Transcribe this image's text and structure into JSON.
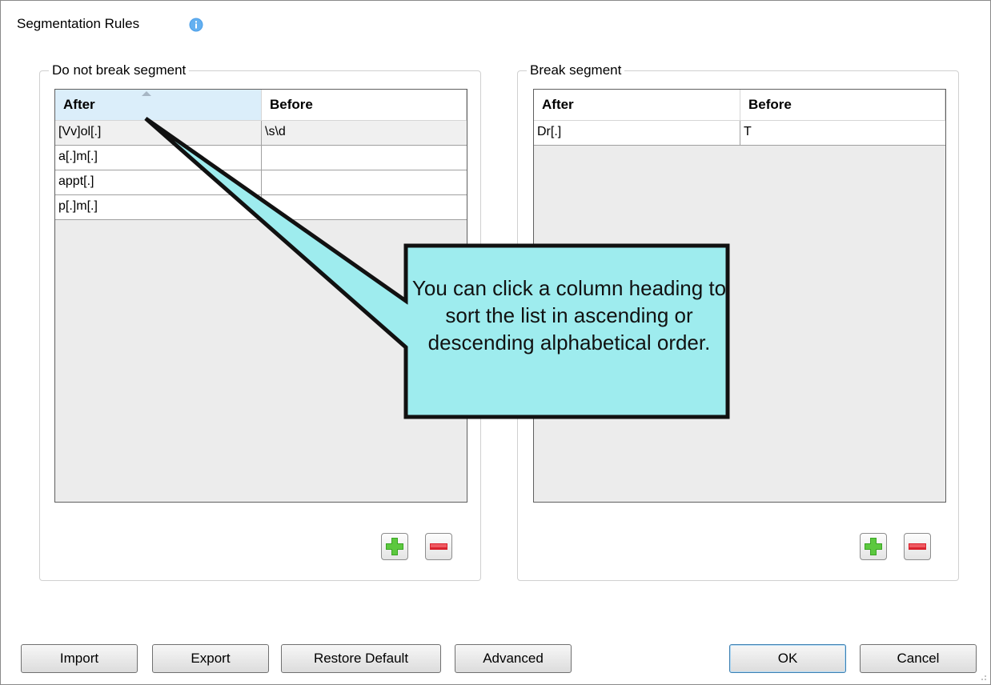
{
  "dialog": {
    "title": "Segmentation Rules"
  },
  "no_break": {
    "group_label": "Do not break segment",
    "columns": [
      "After",
      "Before"
    ],
    "rows": [
      [
        "[Vv]ol[.]",
        "\\s\\d"
      ],
      [
        "a[.]m[.]",
        ""
      ],
      [
        "appt[.]",
        ""
      ],
      [
        "p[.]m[.]",
        ""
      ]
    ]
  },
  "break": {
    "group_label": "Break segment",
    "columns": [
      "After",
      "Before"
    ],
    "rows": [
      [
        "Dr[.]",
        "T"
      ]
    ]
  },
  "buttons": {
    "import": "Import",
    "export": "Export",
    "restore_default": "Restore Default",
    "advanced": "Advanced",
    "ok": "OK",
    "cancel": "Cancel"
  },
  "callout": {
    "text": "You can click a column heading to sort the list in ascending or descending alphabetical order."
  },
  "colors": {
    "callout_fill": "#9eecee",
    "add_icon": "#3aa524",
    "remove_icon": "#d9232e",
    "info_icon": "#4a9ee8"
  }
}
